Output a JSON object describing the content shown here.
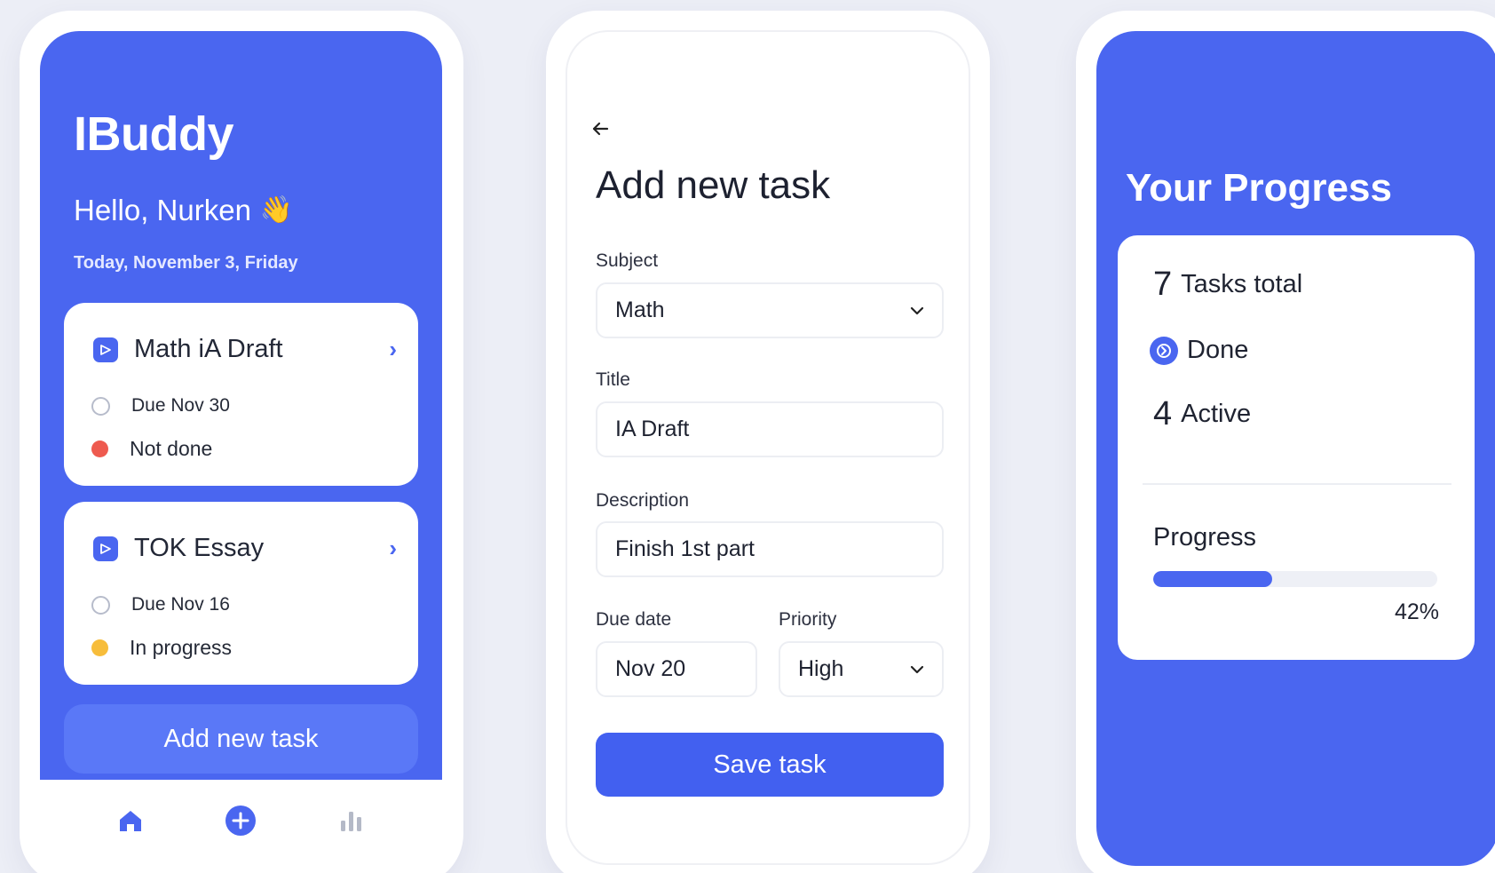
{
  "home": {
    "app_title": "IBuddy",
    "greeting": "Hello, Nurken",
    "greeting_emoji": "👋",
    "date": "Today, November 3, Friday",
    "tasks": [
      {
        "title": "Math iA Draft",
        "due": "Due Nov 30",
        "status": "Not done",
        "status_color": "#ee5a4f"
      },
      {
        "title": "TOK Essay",
        "due": "Due Nov 16",
        "status": "In progress",
        "status_color": "#f7bd3b"
      }
    ],
    "add_button": "Add new task",
    "tabs": [
      {
        "name": "home-icon"
      },
      {
        "name": "add-icon"
      },
      {
        "name": "stats-icon"
      }
    ]
  },
  "add_task": {
    "title": "Add new task",
    "subject_label": "Subject",
    "subject_value": "Math",
    "title_label": "Title",
    "title_value": "IA Draft",
    "description_label": "Description",
    "description_value": "Finish 1st part",
    "due_label": "Due date",
    "due_value": "Nov 20",
    "priority_label": "Priority",
    "priority_value": "High",
    "save_button": "Save task"
  },
  "progress": {
    "heading": "Your Progress",
    "total_num": "7",
    "total_label": "Tasks total",
    "done_label": "Done",
    "active_num": "4",
    "active_label": "Active",
    "progress_label": "Progress",
    "progress_percent": 42,
    "progress_text": "42%"
  },
  "colors": {
    "accent": "#4a66f0",
    "background": "#eceef6"
  }
}
